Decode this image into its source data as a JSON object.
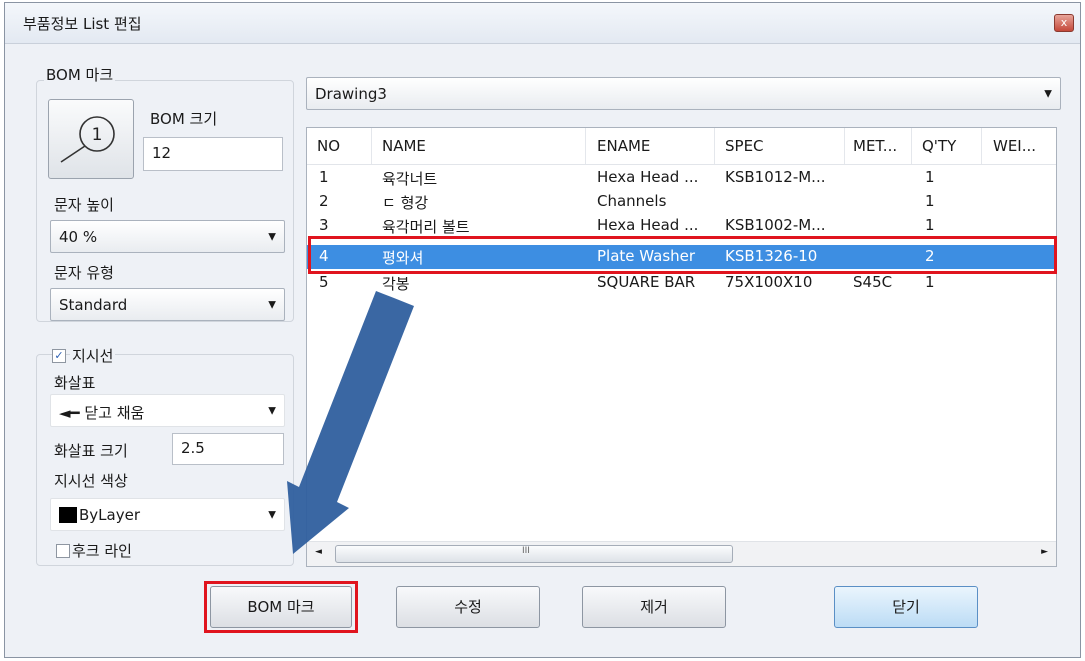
{
  "window": {
    "title": "부품정보 List 편집",
    "close_glyph": "x"
  },
  "left_panel": {
    "bom_mark_group_label": "BOM 마크",
    "bom_size_label": "BOM 크기",
    "bom_size_value": "12",
    "text_height_label": "문자 높이",
    "text_height_value": "40 %",
    "text_style_label": "문자 유형",
    "text_style_value": "Standard",
    "leader_checkbox_label": "지시선",
    "leader_checked": true,
    "arrow_label": "화살표",
    "arrow_value": "닫고 채움",
    "arrow_size_label": "화살표 크기",
    "arrow_size_value": "2.5",
    "leader_color_label": "지시선 색상",
    "leader_color_value": "ByLayer",
    "leader_color_swatch": "#000000",
    "hook_line_label": "후크 라인",
    "hook_line_checked": false
  },
  "drawing_select": {
    "value": "Drawing3"
  },
  "table": {
    "columns": [
      "NO",
      "NAME",
      "ENAME",
      "SPEC",
      "MET...",
      "Q'TY",
      "WEI..."
    ],
    "rows": [
      [
        "1",
        "육각너트",
        "Hexa Head ...",
        "KSB1012-M...",
        "",
        "1",
        ""
      ],
      [
        "2",
        "ㄷ 형강",
        "Channels",
        "",
        "",
        "1",
        ""
      ],
      [
        "3",
        "육각머리 볼트",
        "Hexa Head ...",
        "KSB1002-M...",
        "",
        "1",
        ""
      ],
      [
        "4",
        "평와셔",
        "Plate Washer",
        "KSB1326-10",
        "",
        "2",
        ""
      ],
      [
        "5",
        "각봉",
        "SQUARE BAR",
        "75X100X10",
        "S45C",
        "1",
        ""
      ]
    ],
    "selected_row_index": 3,
    "scroll_mark": "III"
  },
  "buttons": {
    "bom_mark": "BOM 마크",
    "edit": "수정",
    "remove": "제거",
    "close": "닫기"
  },
  "colors": {
    "selection": "#3d8ee2",
    "highlight_box": "#e0141e",
    "annotation_arrow": "#2f5f9e"
  }
}
